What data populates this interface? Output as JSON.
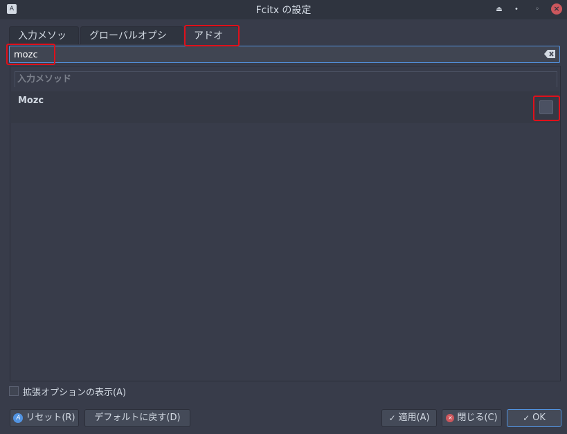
{
  "window": {
    "title": "Fcitx の設定",
    "app_icon": "A"
  },
  "tabs": [
    {
      "label": "入力メソッド"
    },
    {
      "label": "グローバルオプション"
    },
    {
      "label": "アドオン"
    }
  ],
  "search": {
    "value": "mozc"
  },
  "list": {
    "group_header": "入力メソッド",
    "items": [
      {
        "label": "Mozc"
      }
    ]
  },
  "advanced_option_label": "拡張オプションの表示(A)",
  "buttons": {
    "reset": "リセット(R)",
    "reset_icon_glyph": "A",
    "defaults": "デフォルトに戻す(D)",
    "apply": "適用(A)",
    "close": "閉じる(C)",
    "ok": "OK"
  },
  "colors": {
    "accent": "#5294e2",
    "highlight": "#e0101a",
    "close": "#cc575d"
  }
}
